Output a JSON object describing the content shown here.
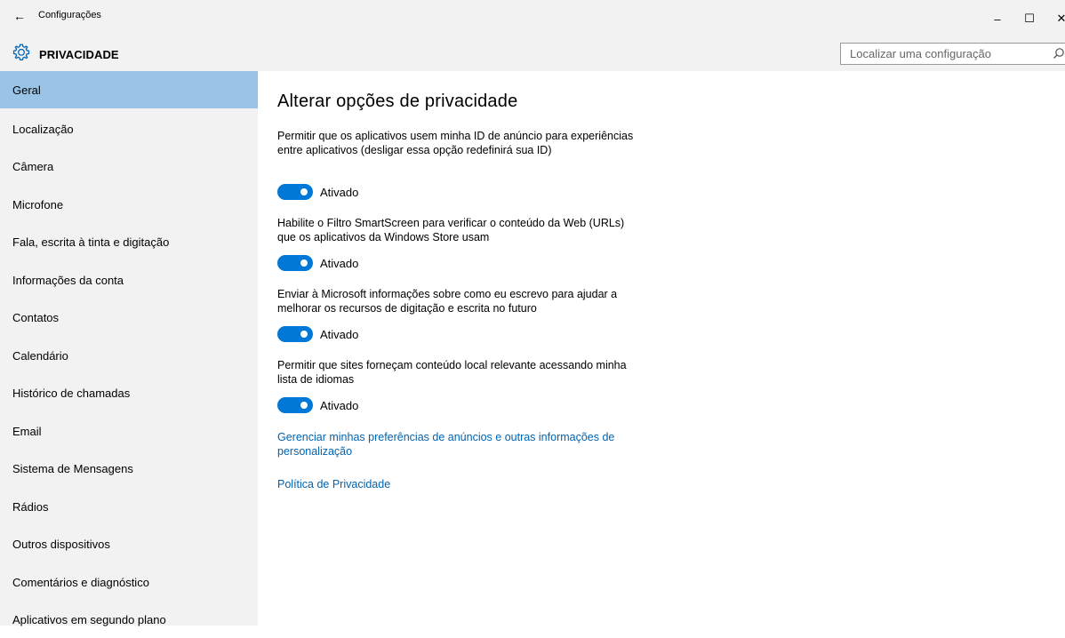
{
  "window": {
    "app_title": "Configurações",
    "back_glyph": "←",
    "minimize_glyph": "–",
    "maximize_glyph": "☐",
    "close_glyph": "✕"
  },
  "header": {
    "section_title": "PRIVACIDADE",
    "icon": "gear-icon",
    "search_placeholder": "Localizar uma configuração",
    "search_icon": "search-icon"
  },
  "sidebar": {
    "items": [
      {
        "label": "Geral",
        "selected": true
      },
      {
        "label": "Localização",
        "selected": false
      },
      {
        "label": "Câmera",
        "selected": false
      },
      {
        "label": "Microfone",
        "selected": false
      },
      {
        "label": "Fala, escrita à tinta e digitação",
        "selected": false
      },
      {
        "label": "Informações da conta",
        "selected": false
      },
      {
        "label": "Contatos",
        "selected": false
      },
      {
        "label": "Calendário",
        "selected": false
      },
      {
        "label": "Histórico de chamadas",
        "selected": false
      },
      {
        "label": "Email",
        "selected": false
      },
      {
        "label": "Sistema de Mensagens",
        "selected": false
      },
      {
        "label": "Rádios",
        "selected": false
      },
      {
        "label": "Outros dispositivos",
        "selected": false
      },
      {
        "label": "Comentários e diagnóstico",
        "selected": false
      },
      {
        "label": "Aplicativos em segundo plano",
        "selected": false
      }
    ],
    "selected_color": "#99c4e8",
    "background_color": "#f2f2f2"
  },
  "main": {
    "title": "Alterar opções de privacidade",
    "settings": [
      {
        "description": "Permitir que os aplicativos usem minha ID de anúncio para experiências entre aplicativos (desligar essa opção redefinirá sua ID)",
        "state": "Ativado",
        "on": true
      },
      {
        "description": "Habilite o Filtro SmartScreen para verificar o conteúdo da Web (URLs) que os aplicativos da Windows Store usam",
        "state": "Ativado",
        "on": true
      },
      {
        "description": "Enviar à Microsoft informações sobre como eu escrevo para ajudar a melhorar os recursos de digitação e escrita no futuro",
        "state": "Ativado",
        "on": true
      },
      {
        "description": "Permitir que sites forneçam conteúdo local relevante acessando minha lista de idiomas",
        "state": "Ativado",
        "on": true
      }
    ],
    "links": [
      {
        "label": "Gerenciar minhas preferências de anúncios e outras informações de personalização"
      },
      {
        "label": "Política de Privacidade"
      }
    ],
    "accent_color": "#0078d7",
    "link_color": "#0063b1"
  }
}
